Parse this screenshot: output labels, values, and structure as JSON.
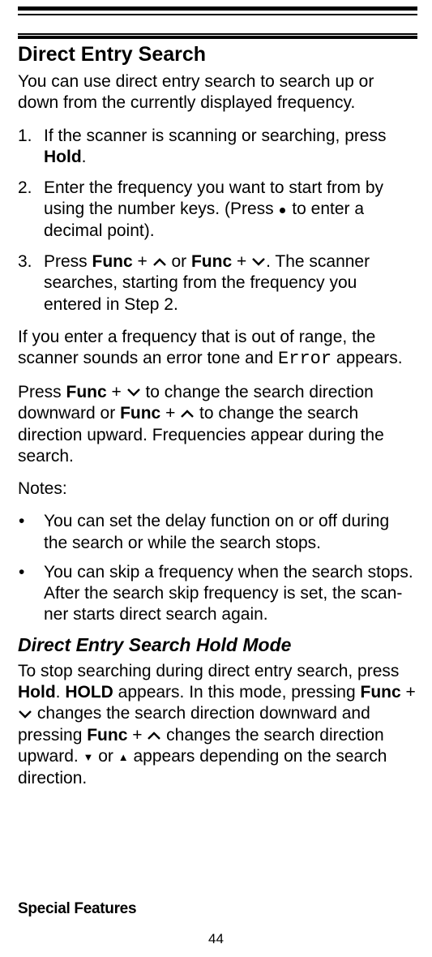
{
  "section": {
    "heading": "Direct Entry Search",
    "intro": "You can use direct entry search to search up or down from the currently displayed frequency."
  },
  "steps": {
    "s1": {
      "num": "1.",
      "pre": "If the scanner is scanning or searching, press ",
      "hold": "Hold",
      "post": "."
    },
    "s2": {
      "num": "2.",
      "text": "Enter the frequency you want to start from by using the number keys. (Press ",
      "post": " to enter a decimal point)."
    },
    "s3": {
      "num": "3.",
      "pre": "Press ",
      "func1": "Func",
      "plus1": " + ",
      "or": " or ",
      "func2": "Func",
      "plus2": " + ",
      "post": ". The scanner searches, starting from the frequency you entered in Step 2."
    }
  },
  "error_para": {
    "pre": "If you enter a frequency that is out of range, the scanner sounds an error tone and ",
    "err": "Error",
    "post": " appears."
  },
  "dir_para": {
    "pre": "Press ",
    "func1": "Func",
    "plus1": " + ",
    "mid1": " to change the search direction downward or ",
    "func2": "Func",
    "plus2": " + ",
    "mid2": " to change the search direction upward. Frequencies appear during the search."
  },
  "notes_label": "Notes:",
  "notes": {
    "n1": "You can set the delay function on or off during the search or while the search stops.",
    "n2": "You can skip a frequency when the search stops. After the search skip frequency is set, the scan­ner starts direct search again."
  },
  "holdmode": {
    "heading": "Direct Entry Search Hold Mode",
    "pre": "To stop searching during direct entry search, press ",
    "hold1": "Hold",
    "mid1": ". ",
    "holdcaps": "HOLD",
    "mid2": " appears. In this mode, pressing ",
    "func1": "Func",
    "plus1": " + ",
    "mid3": " changes the search direction downward and pressing ",
    "func2": "Func",
    "plus2": " + ",
    "mid4": " changes the search direction upward. ",
    "or": " or ",
    "post": " appears depending on the search direction."
  },
  "footer": "Special Features",
  "page": "44"
}
